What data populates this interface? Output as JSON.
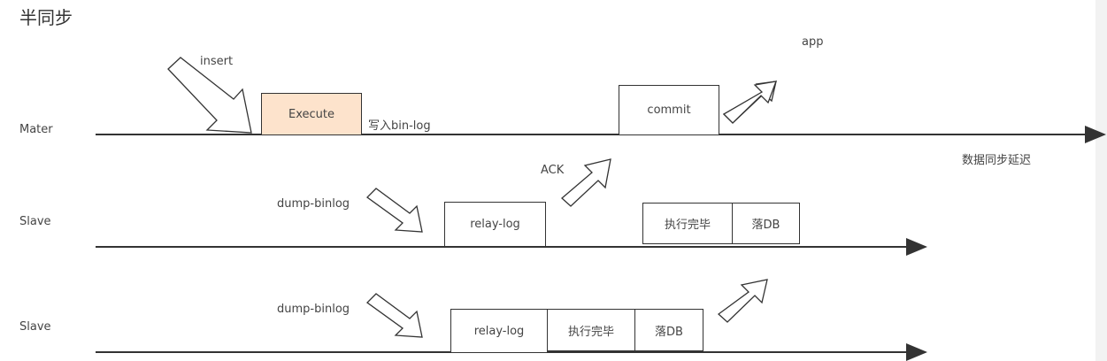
{
  "title": "半同步",
  "lanes": {
    "master": "Mater",
    "slave1": "Slave",
    "slave2": "Slave"
  },
  "labels": {
    "insert": "insert",
    "app": "app",
    "write_binlog": "写入bin-log",
    "ack": "ACK",
    "dump1": "dump-binlog",
    "dump2": "dump-binlog",
    "delay": "数据同步延迟"
  },
  "boxes": {
    "execute": "Execute",
    "commit": "commit",
    "relay1": "relay-log",
    "exec_done1": "执行完毕",
    "to_db1": "落DB",
    "relay2": "relay-log",
    "exec_done2": "执行完毕",
    "to_db2": "落DB"
  },
  "colors": {
    "execute_fill": "#fde3cc",
    "line": "#333333"
  }
}
